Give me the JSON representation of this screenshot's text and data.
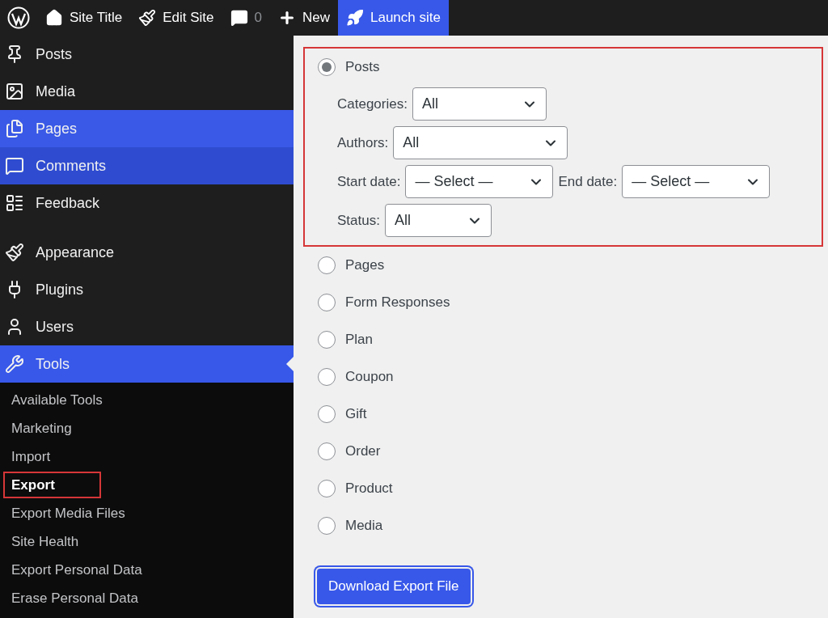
{
  "admin_bar": {
    "items": [
      {
        "kind": "logo"
      },
      {
        "kind": "home",
        "label": "Site Title"
      },
      {
        "kind": "brush",
        "label": "Edit Site"
      },
      {
        "kind": "comments",
        "label": "0"
      },
      {
        "kind": "new",
        "label": "New"
      },
      {
        "kind": "rocket",
        "label": "Launch site",
        "highlighted": true
      }
    ]
  },
  "sidebar": {
    "items": [
      {
        "label": "Posts",
        "selected": false,
        "hovered": false,
        "focused": false
      },
      {
        "label": "Media",
        "selected": false,
        "hovered": false,
        "focused": false
      },
      {
        "label": "Pages",
        "selected": false,
        "hovered": true,
        "focused": false
      },
      {
        "label": "Comments",
        "selected": false,
        "hovered": false,
        "focused": true
      },
      {
        "label": "Feedback",
        "selected": false,
        "hovered": false,
        "focused": false
      },
      {
        "label": "Appearance",
        "selected": false,
        "hovered": false,
        "focused": false
      },
      {
        "label": "Plugins",
        "selected": false,
        "hovered": false,
        "focused": false
      },
      {
        "label": "Users",
        "selected": false,
        "hovered": false,
        "focused": false
      },
      {
        "label": "Tools",
        "selected": true,
        "hovered": false,
        "focused": false
      }
    ],
    "submenu": [
      {
        "label": "Available Tools",
        "selected": false
      },
      {
        "label": "Marketing",
        "selected": false
      },
      {
        "label": "Import",
        "selected": false
      },
      {
        "label": "Export",
        "selected": true,
        "outlined": true
      },
      {
        "label": "Export Media Files",
        "selected": false
      },
      {
        "label": "Site Health",
        "selected": false
      },
      {
        "label": "Export Personal Data",
        "selected": false
      },
      {
        "label": "Erase Personal Data",
        "selected": false
      }
    ]
  },
  "export_options": [
    {
      "label": "Posts",
      "selected": true,
      "outlined": true,
      "filters": [
        {
          "fields": [
            {
              "label": "Categories:",
              "value": "All"
            }
          ]
        },
        {
          "fields": [
            {
              "label": "Authors:",
              "value": "All"
            }
          ]
        },
        {
          "fields": [
            {
              "label": "Start date:",
              "value": "— Select —"
            },
            {
              "label": "End date:",
              "value": "— Select —"
            }
          ]
        },
        {
          "fields": [
            {
              "label": "Status:",
              "value": "All"
            }
          ]
        }
      ]
    },
    {
      "label": "Pages",
      "selected": false
    },
    {
      "label": "Form Responses",
      "selected": false
    },
    {
      "label": "Plan",
      "selected": false
    },
    {
      "label": "Coupon",
      "selected": false
    },
    {
      "label": "Gift",
      "selected": false
    },
    {
      "label": "Order",
      "selected": false
    },
    {
      "label": "Product",
      "selected": false
    },
    {
      "label": "Media",
      "selected": false
    }
  ],
  "download_button": {
    "label": "Download Export File"
  }
}
